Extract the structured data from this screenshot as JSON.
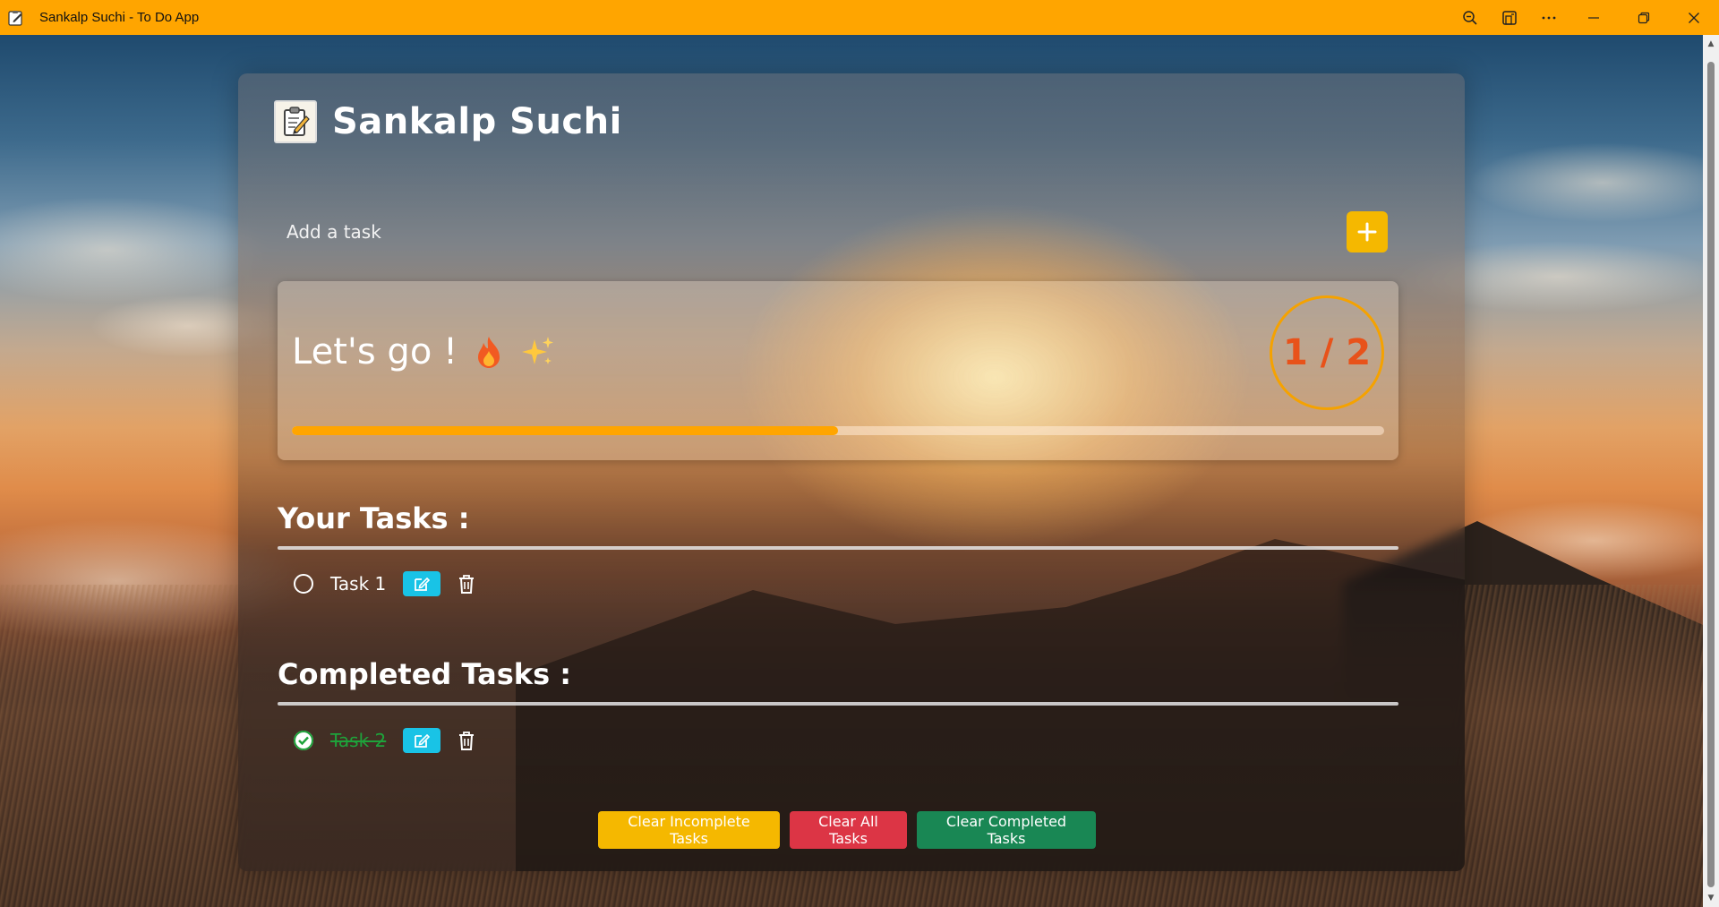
{
  "window": {
    "title": "Sankalp Suchi - To Do App",
    "controls": [
      "zoom-icon",
      "app-view-icon",
      "more-icon",
      "minimize-icon",
      "restore-icon",
      "close-icon"
    ]
  },
  "app": {
    "title": "Sankalp Suchi",
    "logo": "clipboard-memo-icon"
  },
  "add_task": {
    "placeholder": "Add a task",
    "button_icon": "plus-icon"
  },
  "progress": {
    "message": "Let's go !",
    "emojis": [
      "fire-icon",
      "sparkles-icon"
    ],
    "counter": "1 / 2",
    "completed": 1,
    "total": 2,
    "fraction": 0.5
  },
  "sections": {
    "your_tasks": "Your Tasks :",
    "completed_tasks": "Completed Tasks :"
  },
  "tasks": {
    "incomplete": [
      {
        "text": "Task 1"
      }
    ],
    "completed": [
      {
        "text": "Task 2"
      }
    ]
  },
  "actions": {
    "clear_incomplete": "Clear Incomplete Tasks",
    "clear_all": "Clear All Tasks",
    "clear_completed": "Clear Completed Tasks"
  },
  "colors": {
    "titlebar": "#ffa500",
    "accent": "#f5b800",
    "progress": "#ffa500",
    "counter_text": "#e8521a",
    "edit": "#19c3e6",
    "danger": "#dc3545",
    "success": "#198754",
    "done_text": "#1ea33b"
  }
}
